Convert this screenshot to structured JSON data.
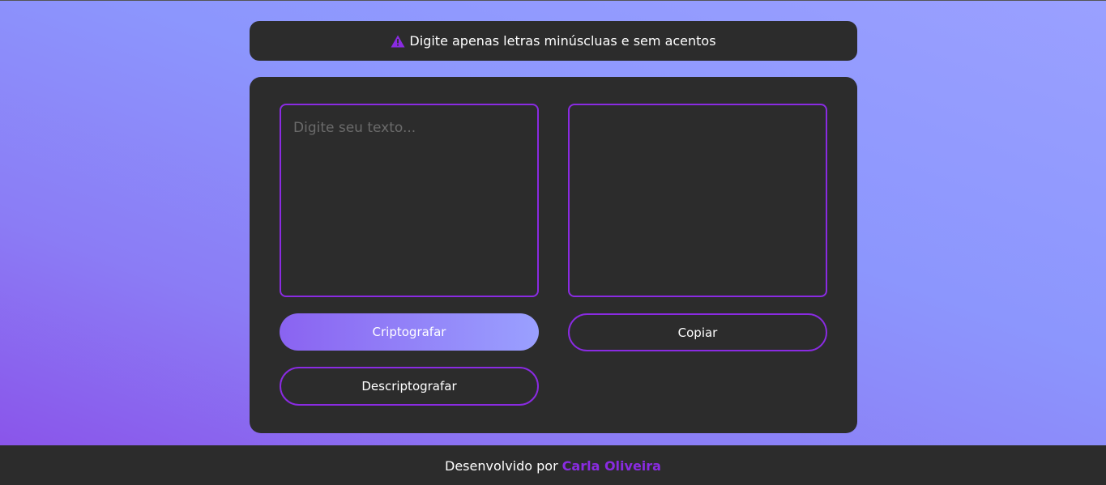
{
  "notice": {
    "icon": "warning-triangle-icon",
    "text": "Digite apenas letras minúscluas e sem acentos"
  },
  "input": {
    "placeholder": "Digite seu texto...",
    "value": ""
  },
  "output": {
    "value": ""
  },
  "buttons": {
    "encrypt_label": "Criptografar",
    "copy_label": "Copiar",
    "decrypt_label": "Descriptografar"
  },
  "footer": {
    "text": "Desenvolvido por",
    "author_link": "Carla Oliveira"
  },
  "colors": {
    "accent": "#8a2be2",
    "panel": "#2c2c2c",
    "gradient_start": "#8a4ee8",
    "gradient_end": "#9aa0ff"
  }
}
